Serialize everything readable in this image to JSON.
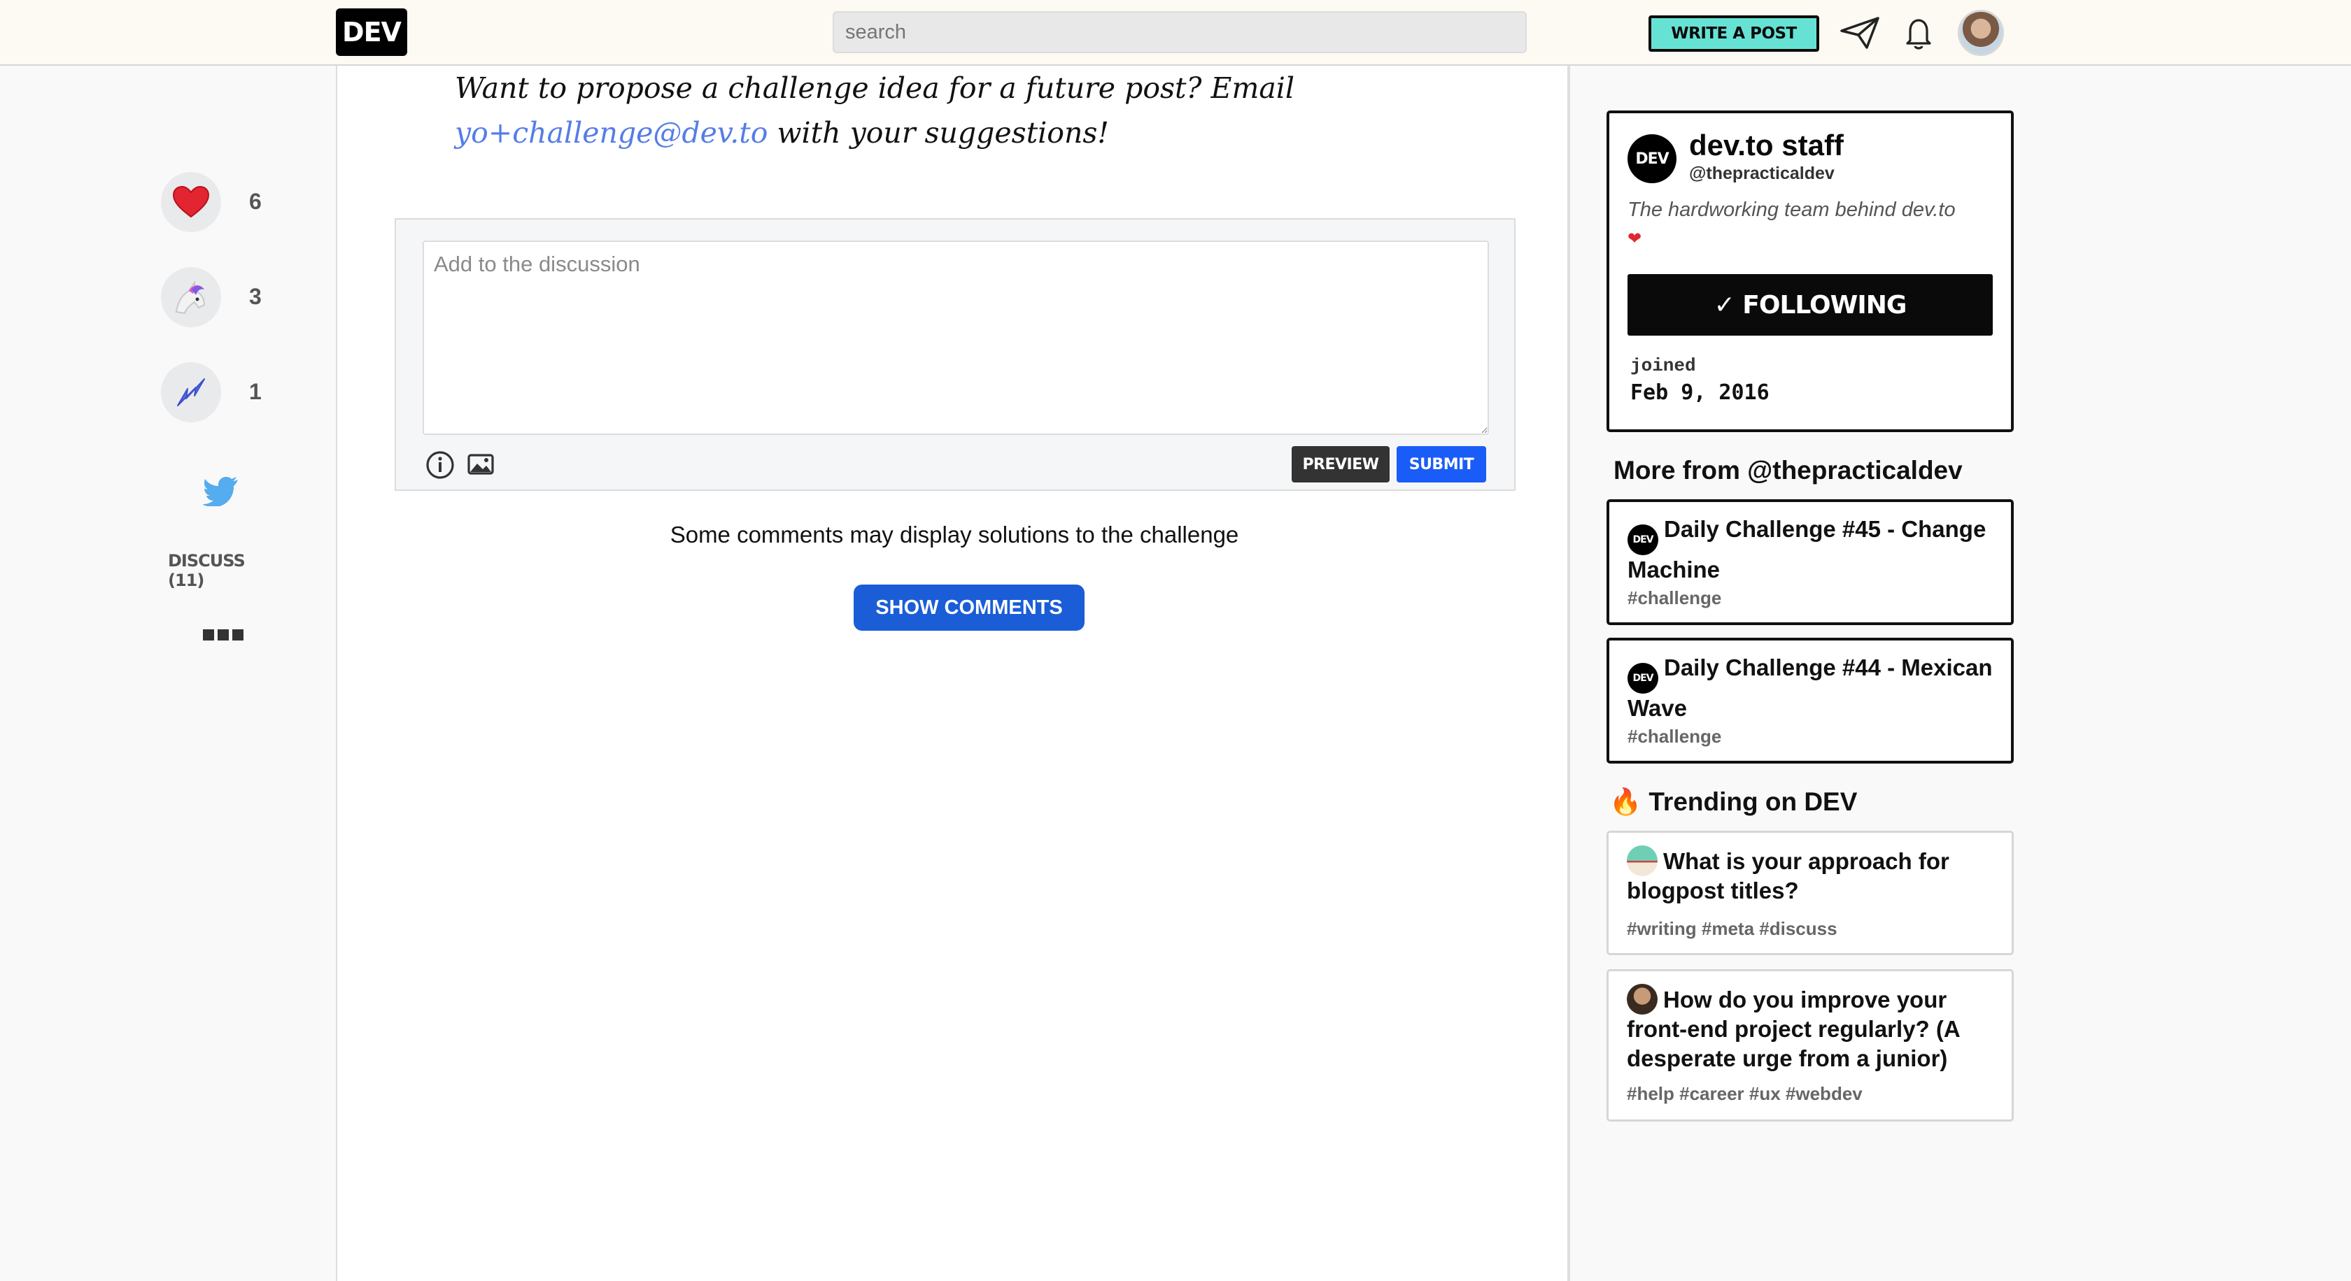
{
  "nav": {
    "logo": "DEV",
    "search_placeholder": "search",
    "write_post_label": "WRITE A POST"
  },
  "reactions": {
    "hearts": "6",
    "unicorns": "3",
    "bookmarks": "1",
    "discuss_label": "DISCUSS (11)"
  },
  "article": {
    "closing_before": "Want to propose a challenge idea for a future post? Email ",
    "email": "yo+challenge@dev.to",
    "closing_after": " with your suggestions!"
  },
  "comment": {
    "placeholder": "Add to the discussion",
    "preview_label": "PREVIEW",
    "submit_label": "SUBMIT",
    "solutions_note": "Some comments may display solutions to the challenge",
    "show_comments_label": "SHOW COMMENTS"
  },
  "profile": {
    "logo": "DEV",
    "name": "dev.to staff",
    "handle": "@thepracticaldev",
    "bio": "The hardworking team behind dev.to",
    "following_label": "✓ FOLLOWING",
    "joined_label": "joined",
    "joined_date": "Feb 9, 2016"
  },
  "more_from": {
    "title": "More from @thepracticaldev",
    "posts": [
      {
        "logo": "DEV",
        "title": "Daily Challenge #45 - Change Machine",
        "tags": "#challenge"
      },
      {
        "logo": "DEV",
        "title": "Daily Challenge #44 - Mexican Wave",
        "tags": "#challenge"
      }
    ]
  },
  "trending": {
    "title": "Trending on DEV",
    "posts": [
      {
        "title": "What is your approach for blogpost titles?",
        "tags": "#writing #meta #discuss"
      },
      {
        "title": "How do you improve your front-end project regularly? (A desperate urge from a junior)",
        "tags": "#help #career #ux #webdev"
      }
    ]
  },
  "colors": {
    "accent_teal": "#66e2d5",
    "submit_blue": "#1a5cf7",
    "show_comments_blue": "#1a5dd7",
    "link_blue": "#557de8"
  },
  "icons": {
    "hearts": "heart-icon",
    "unicorns": "unicorn-icon",
    "bookmarks": "bookmark-icon",
    "twitter": "twitter-icon",
    "info": "info-icon",
    "image_upload": "image-icon",
    "send": "paper-plane-icon",
    "notifications": "bell-icon",
    "trending": "fire-icon"
  }
}
